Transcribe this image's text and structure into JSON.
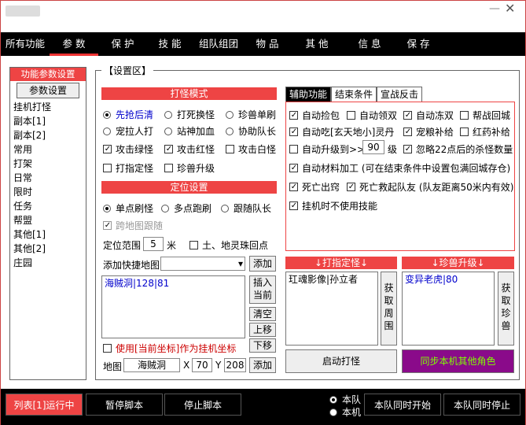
{
  "menu": [
    "所有功能",
    "参 数",
    "保 护",
    "技 能",
    "组队组团",
    "物 品",
    "其 他",
    "信 息",
    "保 存"
  ],
  "leftnav": {
    "header": "功能参数设置",
    "selected": "参数设置",
    "items": [
      "挂机打怪",
      "副本[1]",
      "副本[2]",
      "常用",
      "打架",
      "日常",
      "限时",
      "任务",
      "帮盟",
      "其他[1]",
      "其他[2]",
      "庄园"
    ]
  },
  "group_title": "【设置区】",
  "attack_mode": {
    "header": "打怪模式",
    "r1": [
      "先抢后清",
      "打死换怪",
      "珍兽单刷"
    ],
    "r2": [
      "宠拉人打",
      "站神加血",
      "协助队长"
    ],
    "c3": [
      "攻击绿怪",
      "攻击红怪",
      "攻击白怪"
    ],
    "c4": [
      "打指定怪",
      "珍兽升级"
    ]
  },
  "locate": {
    "header": "定位设置",
    "r1": [
      "单点刷怪",
      "多点跑刷",
      "跟随队长"
    ],
    "cross_map": "跨地图跟随",
    "range_label": "定位范围",
    "range_value": "5",
    "range_unit": "米",
    "earth_label": "土、地灵珠回点",
    "quick_map_label": "添加快捷地图",
    "add_button": "添加",
    "list_item": "海贼洞|128|81",
    "insert_btn": "插入当前",
    "clear_btn": "清空",
    "up_btn": "上移",
    "down_btn": "下移",
    "use_coord": "使用[当前坐标]作为挂机坐标",
    "map_label": "地图",
    "map_value": "海贼洞",
    "x_label": "X",
    "x_value": "70",
    "y_label": "Y",
    "y_value": "208",
    "add_button2": "添加"
  },
  "right_tabs": [
    "辅助功能",
    "结束条件",
    "宣战反击"
  ],
  "aux": {
    "r1": [
      "自动捡包",
      "自动领双",
      "自动冻双",
      "帮战回城"
    ],
    "r2": [
      "自动吃[玄天地小]灵丹",
      "宠粮补给",
      "红药补给"
    ],
    "r3a": "自动升级到>>",
    "r3_value": "90",
    "r3b": "级",
    "r3c": "忽略22点后的杀怪数量",
    "r4": "自动材料加工 (可在结束条件中设置包满回城存仓)",
    "r5a": "死亡出窍",
    "r5b": "死亡救起队友 (队友距离50米内有效)",
    "r6": "挂机时不使用技能"
  },
  "target_monster": {
    "header": "↓打指定怪↓",
    "item": "玒魂影像|孙立者",
    "btn": "获取周围"
  },
  "pet_upgrade": {
    "header": "↓珍兽升级↓",
    "item": "变异老虎|80",
    "btn": "获取珍兽"
  },
  "start_btn": "启动打怪",
  "sync_btn": "同步本机其他角色",
  "bottom": {
    "run": "列表[1]运行中",
    "pause": "暂停脚本",
    "stop": "停止脚本",
    "radio1": "本队",
    "radio2": "本机",
    "sync_start": "本队同时开始",
    "sync_stop": "本队同时停止"
  },
  "colors": {
    "accent": "#e44444",
    "sync_btn": "#8a0a8a",
    "sync_text": "#7fff00"
  }
}
